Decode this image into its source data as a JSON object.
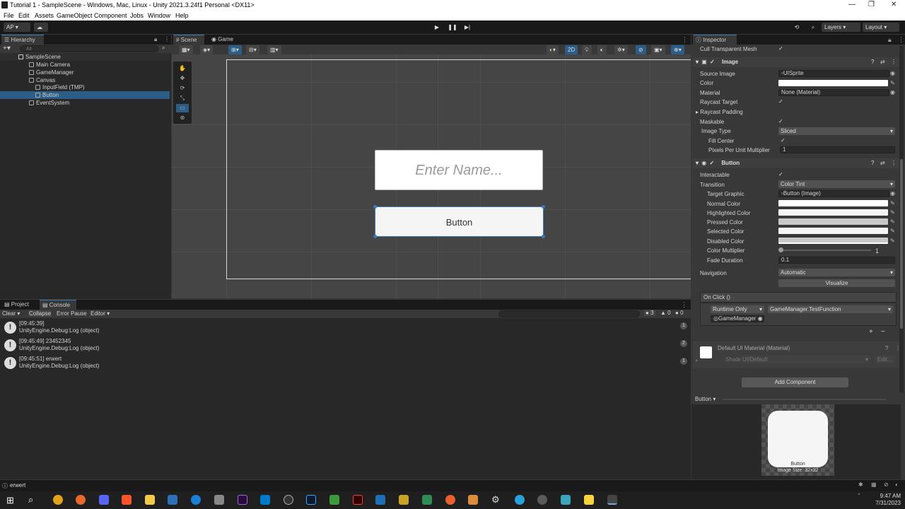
{
  "window": {
    "title": "Tutorial 1 - SampleScene - Windows, Mac, Linux - Unity 2021.3.24f1 Personal <DX11>"
  },
  "menu": [
    "File",
    "Edit",
    "Assets",
    "GameObject",
    "Component",
    "Jobs",
    "Window",
    "Help"
  ],
  "toolbar": {
    "account": "AP",
    "layers": "Layers",
    "layout": "Layout"
  },
  "hierarchy": {
    "tab": "Hierarchy",
    "search_placeholder": "All",
    "items": [
      "SampleScene",
      "Main Camera",
      "GameManager",
      "Canvas",
      "InputField (TMP)",
      "Button",
      "EventSystem"
    ]
  },
  "scene": {
    "tabs": [
      "Scene",
      "Game"
    ],
    "mode_2d": "2D",
    "input_placeholder": "Enter Name...",
    "button_label": "Button"
  },
  "console": {
    "tabs": [
      "Project",
      "Console"
    ],
    "buttons": [
      "Clear",
      "Collapse",
      "Error Pause",
      "Editor"
    ],
    "counts": [
      "3",
      "0",
      "0"
    ],
    "messages": [
      {
        "line1": "[09:45:39]",
        "line2": "UnityEngine.Debug:Log (object)",
        "count": "1"
      },
      {
        "line1": "[09:45:49] 23452345",
        "line2": "UnityEngine.Debug:Log (object)",
        "count": "2"
      },
      {
        "line1": "[09:45:51] erwert",
        "line2": "UnityEngine.Debug:Log (object)",
        "count": "1"
      }
    ]
  },
  "inspector": {
    "tab": "Inspector",
    "cull_transparent_mesh": "Cull Transparent Mesh",
    "image": {
      "header": "Image",
      "source_image_label": "Source Image",
      "source_image_value": "UISprite",
      "color_label": "Color",
      "material_label": "Material",
      "material_value": "None (Material)",
      "raycast_target": "Raycast Target",
      "raycast_padding": "Raycast Padding",
      "maskable": "Maskable",
      "image_type_label": "Image Type",
      "image_type_value": "Sliced",
      "fill_center": "Fill Center",
      "ppu_label": "Pixels Per Unit Multiplier",
      "ppu_value": "1"
    },
    "button": {
      "header": "Button",
      "interactable": "Interactable",
      "transition_label": "Transition",
      "transition_value": "Color Tint",
      "target_graphic_label": "Target Graphic",
      "target_graphic_value": "Button (Image)",
      "normal": "Normal Color",
      "highlighted": "Highlighted Color",
      "pressed": "Pressed Color",
      "selected": "Selected Color",
      "disabled": "Disabled Color",
      "multiplier_label": "Color Multiplier",
      "multiplier_value": "1",
      "fade_label": "Fade Duration",
      "fade_value": "0.1",
      "navigation_label": "Navigation",
      "navigation_value": "Automatic",
      "visualize": "Visualize",
      "onclick": "On Click ()",
      "runtime": "Runtime Only",
      "function": "GameManager.TestFunction",
      "object": "GameManager"
    },
    "material": {
      "name": "Default UI Material (Material)",
      "shader_label": "Shader",
      "shader_value": "UI/Default",
      "edit": "Edit..."
    },
    "add_component": "Add Component",
    "preview_title": "Button",
    "preview_caption": "Button",
    "preview_size": "Image Size: 32x32"
  },
  "status": {
    "text": "erwert"
  },
  "clock": {
    "time": "9:47 AM",
    "date": "7/31/2023"
  }
}
